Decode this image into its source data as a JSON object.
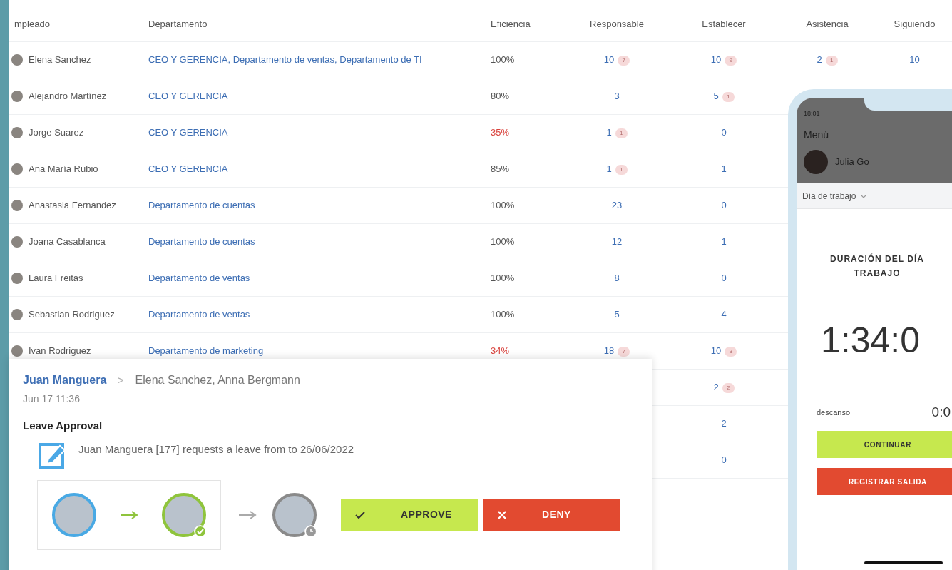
{
  "table": {
    "columns": [
      "mpleado",
      "Departamento",
      "Eficiencia",
      "Responsable",
      "Establecer",
      "Asistencia",
      "Siguiendo"
    ],
    "rows": [
      {
        "employee": "Elena Sanchez",
        "department": "CEO Y GERENCIA, Departamento de ventas, Departamento de TI",
        "efficiency": "100%",
        "low": false,
        "responsible": {
          "value": "10",
          "badge": "7"
        },
        "assigned": {
          "value": "10",
          "badge": "9"
        },
        "attendance": {
          "value": "2",
          "badge": "1"
        },
        "following": {
          "value": "10"
        }
      },
      {
        "employee": "Alejandro Martínez",
        "department": "CEO Y GERENCIA",
        "efficiency": "80%",
        "low": false,
        "responsible": {
          "value": "3"
        },
        "assigned": {
          "value": "5",
          "badge": "1"
        }
      },
      {
        "employee": "Jorge Suarez",
        "department": "CEO Y GERENCIA",
        "efficiency": "35%",
        "low": true,
        "responsible": {
          "value": "1",
          "badge": "1"
        },
        "assigned": {
          "value": "0"
        }
      },
      {
        "employee": "Ana María Rubio",
        "department": "CEO Y GERENCIA",
        "efficiency": "85%",
        "low": false,
        "responsible": {
          "value": "1",
          "badge": "1"
        },
        "assigned": {
          "value": "1"
        }
      },
      {
        "employee": "Anastasia Fernandez",
        "department": "Departamento de cuentas",
        "efficiency": "100%",
        "low": false,
        "responsible": {
          "value": "23"
        },
        "assigned": {
          "value": "0"
        }
      },
      {
        "employee": "Joana Casablanca",
        "department": "Departamento de cuentas",
        "efficiency": "100%",
        "low": false,
        "responsible": {
          "value": "12"
        },
        "assigned": {
          "value": "1"
        }
      },
      {
        "employee": "Laura Freitas",
        "department": "Departamento de ventas",
        "efficiency": "100%",
        "low": false,
        "responsible": {
          "value": "8"
        },
        "assigned": {
          "value": "0"
        }
      },
      {
        "employee": "Sebastian Rodriguez",
        "department": "Departamento de ventas",
        "efficiency": "100%",
        "low": false,
        "responsible": {
          "value": "5"
        },
        "assigned": {
          "value": "4"
        }
      },
      {
        "employee": "Ivan Rodriguez",
        "department": "Departamento de marketing",
        "efficiency": "34%",
        "low": true,
        "responsible": {
          "value": "18",
          "badge": "7"
        },
        "assigned": {
          "value": "10",
          "badge": "3"
        }
      },
      {
        "assigned": {
          "value": "2",
          "badge": "2"
        }
      },
      {
        "assigned": {
          "value": "2"
        }
      },
      {
        "assigned": {
          "value": "0"
        }
      }
    ]
  },
  "notification": {
    "sender": "Juan Manguera",
    "separator": ">",
    "recipients": "Elena Sanchez, Anna Bergmann",
    "date": "Jun 17 11:36",
    "title": "Leave Approval",
    "message": "Juan Manguera [177] requests a leave from to 26/06/2022",
    "steps": [
      {
        "kind": "requester"
      },
      {
        "kind": "approved"
      },
      {
        "kind": "waiting"
      }
    ],
    "actions": [
      {
        "kind": "approve",
        "label": "APPROVE"
      },
      {
        "kind": "deny",
        "label": "DENY"
      }
    ]
  },
  "phone": {
    "time": "18:01",
    "menu_title": "Menú",
    "user": "Julia Go",
    "selector": "Día de trabajo",
    "heading": "DURACIÓN DEL DÍA TRABAJO",
    "duration": "1:34:0",
    "break_label": "descanso",
    "break_value": "0:0",
    "buttons": [
      {
        "kind": "continue",
        "label": "CONTINUAR"
      },
      {
        "kind": "checkout",
        "label": "REGISTRAR SALIDA"
      }
    ]
  }
}
